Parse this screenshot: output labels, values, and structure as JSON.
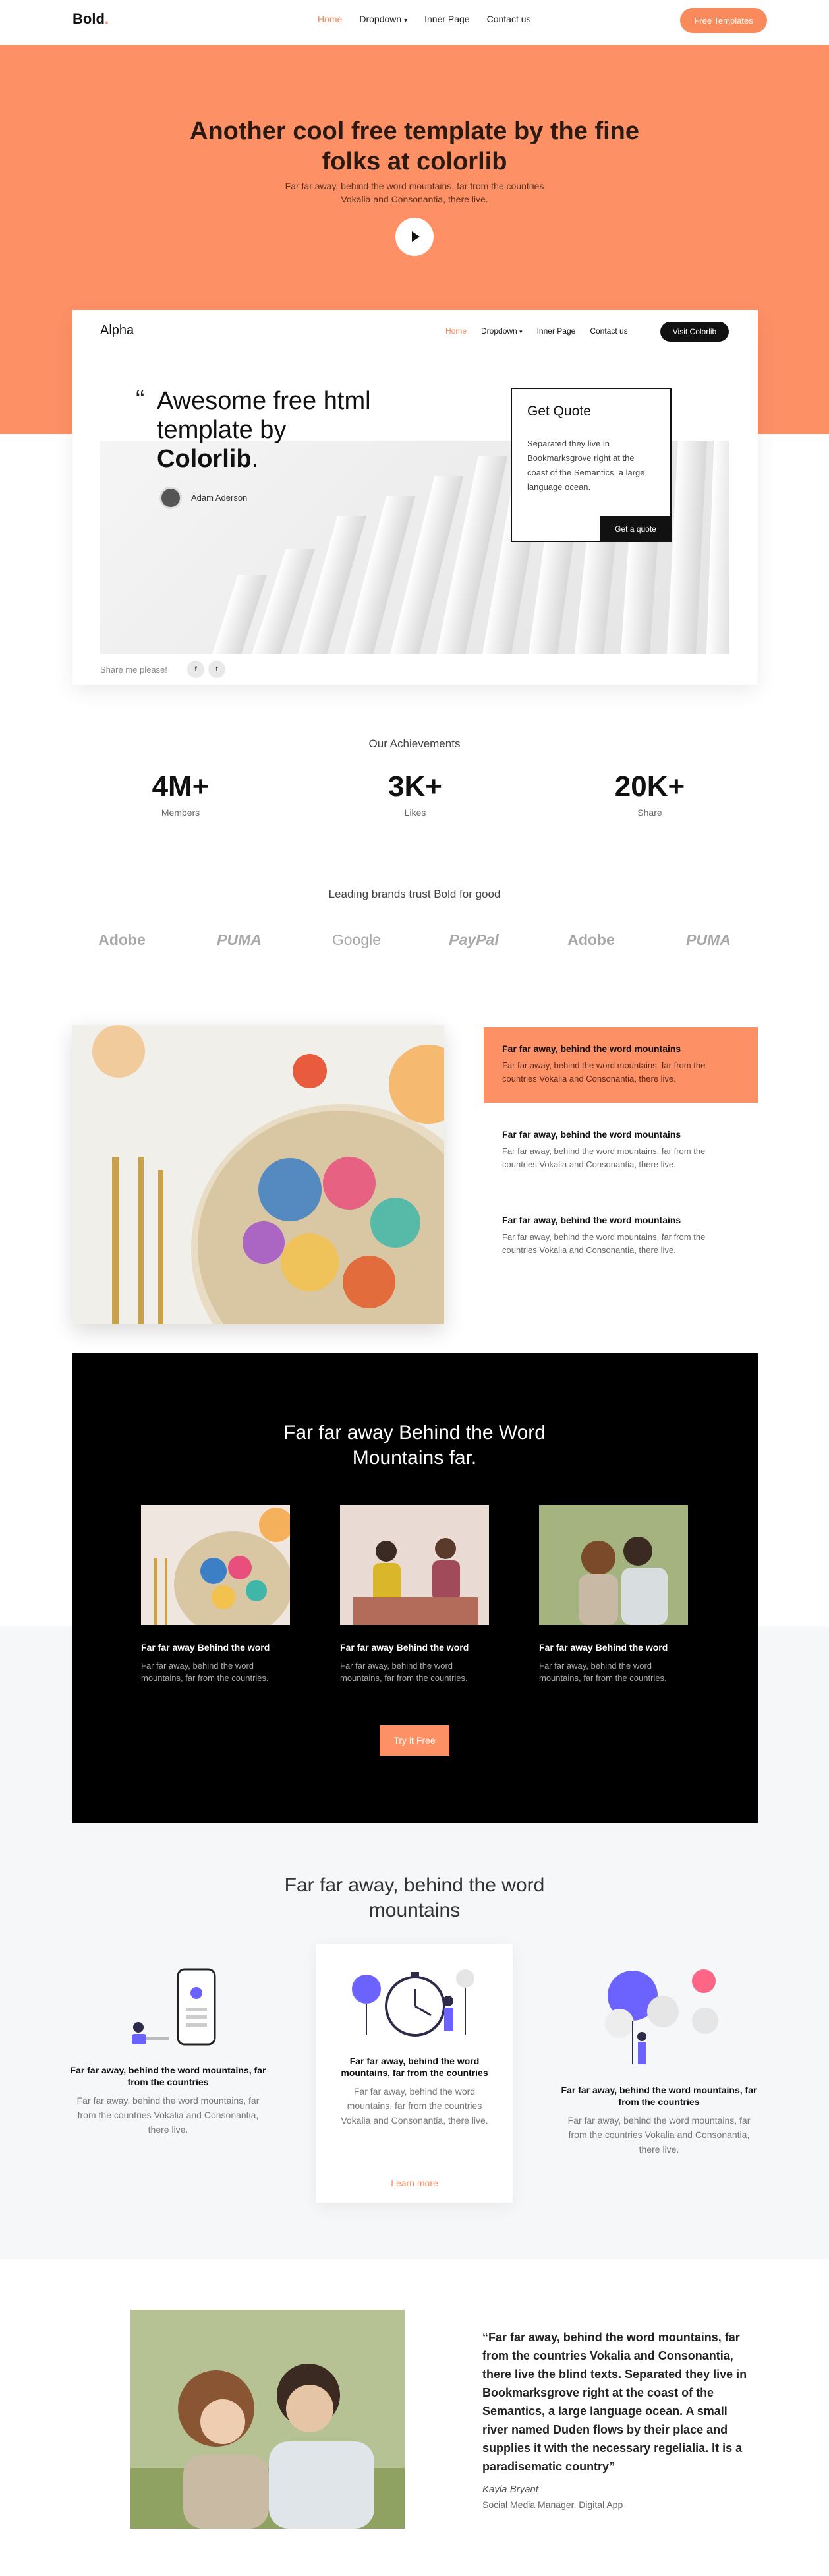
{
  "header": {
    "logo": "Bold",
    "nav": [
      "Home",
      "Dropdown",
      "Inner Page",
      "Contact us"
    ],
    "cta": "Free Templates"
  },
  "hero": {
    "title": "Another cool free template by the fine folks at colorlib",
    "subtitle": "Far far away, behind the word mountains, far from the countries Vokalia and Consonantia, there live."
  },
  "mockup": {
    "brand": "Alpha",
    "nav": [
      "Home",
      "Dropdown",
      "Inner Page",
      "Contact us"
    ],
    "cta": "Visit Colorlib",
    "headline_pre": "Awesome free html template by",
    "headline_bold": "Colorlib",
    "author": "Adam Aderson",
    "quote_title": "Get Quote",
    "quote_text": "Separated they live in Bookmarksgrove right at the coast of the Semantics, a large language ocean.",
    "quote_button": "Get a quote",
    "share_label": "Share me please!"
  },
  "achievements": {
    "title": "Our Achievements",
    "stats": [
      {
        "value": "4M+",
        "label": "Members"
      },
      {
        "value": "3K+",
        "label": "Likes"
      },
      {
        "value": "20K+",
        "label": "Share"
      }
    ]
  },
  "brands": {
    "title": "Leading brands trust Bold for good",
    "logos": [
      "Adobe",
      "PUMA",
      "Google",
      "PayPal",
      "Adobe",
      "PUMA"
    ]
  },
  "features": [
    {
      "title": "Far far away, behind the word mountains",
      "text": "Far far away, behind the word mountains, far from the countries Vokalia and Consonantia, there live."
    },
    {
      "title": "Far far away, behind the word mountains",
      "text": "Far far away, behind the word mountains, far from the countries Vokalia and Consonantia, there live."
    },
    {
      "title": "Far far away, behind the word mountains",
      "text": "Far far away, behind the word mountains, far from the countries Vokalia and Consonantia, there live."
    }
  ],
  "dark": {
    "title": "Far far away Behind the Word Mountains far.",
    "cards": [
      {
        "title": "Far far away Behind the word",
        "text": "Far far away, behind the word mountains, far from the countries."
      },
      {
        "title": "Far far away Behind the word",
        "text": "Far far away, behind the word mountains, far from the countries."
      },
      {
        "title": "Far far away Behind the word",
        "text": "Far far away, behind the word mountains, far from the countries."
      }
    ],
    "button": "Try it Free"
  },
  "services": {
    "title": "Far far away, behind the word mountains",
    "items": [
      {
        "title": "Far far away, behind the word mountains, far from the countries",
        "text": "Far far away, behind the word mountains, far from the countries Vokalia and Consonantia, there live."
      },
      {
        "title": "Far far away, behind the word mountains, far from the countries",
        "text": "Far far away, behind the word mountains, far from the countries Vokalia and Consonantia, there live."
      },
      {
        "title": "Far far away, behind the word mountains, far from the countries",
        "text": "Far far away, behind the word mountains, far from the countries Vokalia and Consonantia, there live."
      }
    ],
    "learn_more": "Learn more"
  },
  "testimonial": {
    "quote": "“Far far away, behind the word mountains, far from the countries Vokalia and Consonantia, there live the blind texts. Separated they live in Bookmarksgrove right at the coast of the Semantics, a large language ocean. A small river named Duden flows by their place and supplies it with the necessary regelialia. It is a paradisematic country”",
    "name": "Kayla Bryant",
    "role": "Social Media Manager, Digital App"
  },
  "colors": {
    "accent": "#fe9066",
    "dark": "#000000"
  }
}
